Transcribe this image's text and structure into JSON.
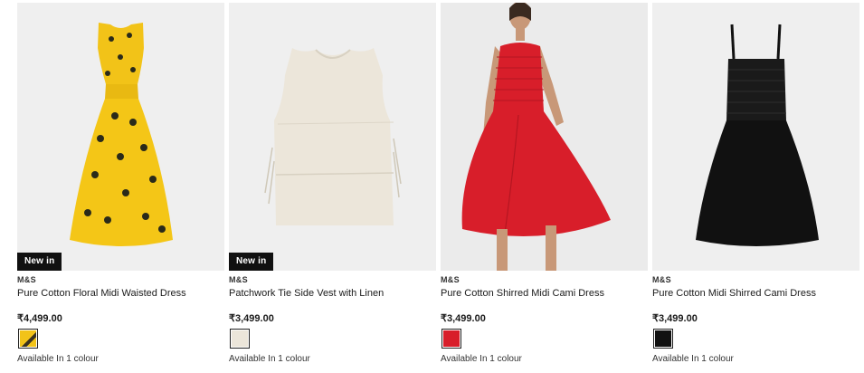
{
  "products": [
    {
      "badge": "New in",
      "brand": "M&S",
      "title": "Pure Cotton Floral Midi Waisted Dress",
      "price": "₹4,499.00",
      "swatch_color": "#f2c318",
      "availability": "Available In 1 colour"
    },
    {
      "badge": "New in",
      "brand": "M&S",
      "title": "Patchwork Tie Side Vest with Linen",
      "price": "₹3,499.00",
      "swatch_color": "#ece6da",
      "availability": "Available In 1 colour"
    },
    {
      "badge": "",
      "brand": "M&S",
      "title": "Pure Cotton Shirred Midi Cami Dress",
      "price": "₹3,499.00",
      "swatch_color": "#d81e2a",
      "availability": "Available In 1 colour"
    },
    {
      "badge": "",
      "brand": "M&S",
      "title": "Pure Cotton Midi Shirred Cami Dress",
      "price": "₹3,499.00",
      "swatch_color": "#111111",
      "availability": "Available In 1 colour"
    }
  ]
}
